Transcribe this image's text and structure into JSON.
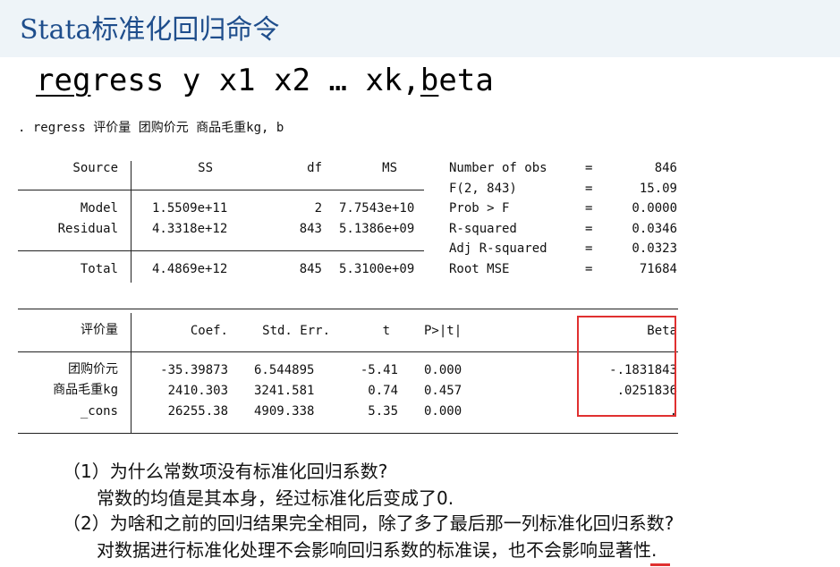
{
  "slide": {
    "title": "Stata标准化回归命令",
    "command": {
      "pre": "",
      "reg": "reg",
      "ress": "ress y x1 x2 … xk,",
      "b": "b",
      "eta": "eta"
    }
  },
  "stata_prompt": ". regress 评价量 团购价元 商品毛重kg, b",
  "anova": {
    "headers": [
      "Source",
      "SS",
      "df",
      "MS"
    ],
    "rows": [
      {
        "source": "Model",
        "ss": "1.5509e+11",
        "df": "2",
        "ms": "7.7543e+10"
      },
      {
        "source": "Residual",
        "ss": "4.3318e+12",
        "df": "843",
        "ms": "5.1386e+09"
      },
      {
        "source": "Total",
        "ss": "4.4869e+12",
        "df": "845",
        "ms": "5.3100e+09"
      }
    ]
  },
  "stats": [
    {
      "label": "Number of obs",
      "eq": "=",
      "value": "846"
    },
    {
      "label": "F(2, 843)",
      "eq": "=",
      "value": "15.09"
    },
    {
      "label": "Prob > F",
      "eq": "=",
      "value": "0.0000"
    },
    {
      "label": "R-squared",
      "eq": "=",
      "value": "0.0346"
    },
    {
      "label": "Adj R-squared",
      "eq": "=",
      "value": "0.0323"
    },
    {
      "label": "Root MSE",
      "eq": "=",
      "value": "71684"
    }
  ],
  "coef_table": {
    "headers": {
      "var": "评价量",
      "coef": "Coef.",
      "se": "Std. Err.",
      "t": "t",
      "p": "P>|t|",
      "beta": "Beta"
    },
    "rows": [
      {
        "var": "团购价元",
        "coef": "-35.39873",
        "se": "6.544895",
        "t": "-5.41",
        "p": "0.000",
        "beta": "-.1831843"
      },
      {
        "var": "商品毛重kg",
        "coef": "2410.303",
        "se": "3241.581",
        "t": "0.74",
        "p": "0.457",
        "beta": ".0251836"
      },
      {
        "var": "_cons",
        "coef": "26255.38",
        "se": "4909.338",
        "t": "5.35",
        "p": "0.000",
        "beta": "."
      }
    ]
  },
  "notes": {
    "q1": "（1）为什么常数项没有标准化回归系数?",
    "a1": "常数的均值是其本身，经过标准化后变成了0.",
    "q2": "（2）为啥和之前的回归结果完全相同，除了多了最后那一列标准化回归系数?",
    "a2": "对数据进行标准化处理不会影响回归系数的标准误，也不会影响显著性."
  }
}
